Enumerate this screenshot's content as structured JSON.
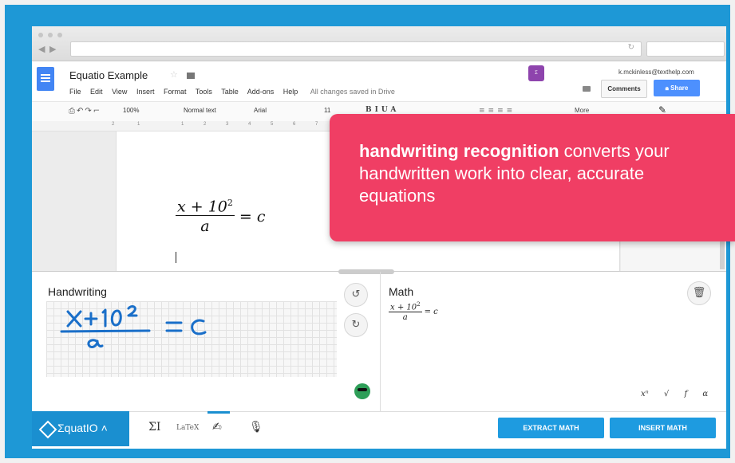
{
  "doc": {
    "title": "Equatio Example",
    "menu": [
      "File",
      "Edit",
      "View",
      "Insert",
      "Format",
      "Tools",
      "Table",
      "Add-ons",
      "Help"
    ],
    "saved_status": "All changes saved in Drive",
    "user_email": "k.mckinless@texthelp.com",
    "comments_label": "Comments",
    "share_label": "Share",
    "toolbar": {
      "zoom": "100%",
      "style": "Normal text",
      "font": "Arial",
      "size": "11",
      "more": "More"
    },
    "ruler_marks": [
      "2",
      "1",
      "1",
      "2",
      "3",
      "4",
      "5",
      "6",
      "7"
    ],
    "equation": {
      "num_main": "x + 10",
      "num_exp": "2",
      "den": "a",
      "rhs": "= c"
    }
  },
  "callout": {
    "bold": "handwriting recognition",
    "rest": " converts your handwritten work into clear, accurate equations"
  },
  "equatio": {
    "handwriting_title": "Handwriting",
    "math_title": "Math",
    "math_equation": {
      "num_main": "x + 10",
      "num_exp": "2",
      "den": "a",
      "rhs": "= c"
    },
    "symbols": [
      "xⁿ",
      "√",
      "f",
      "α"
    ],
    "logo": "ΣquatIO",
    "tools": [
      "ΣI",
      "LaTeX"
    ],
    "extract_label": "EXTRACT MATH",
    "insert_label": "INSERT MATH"
  },
  "colors": {
    "background": "#1e98d6",
    "callout": "#f03e64",
    "accent": "#1e9be0",
    "docs_blue": "#4285f4",
    "handwriting_ink": "#1a6fc9"
  },
  "icons": [
    "undo-icon",
    "redo-icon",
    "trash-icon",
    "smiley-icon",
    "pen-icon",
    "microphone-icon",
    "share-lock-icon"
  ]
}
